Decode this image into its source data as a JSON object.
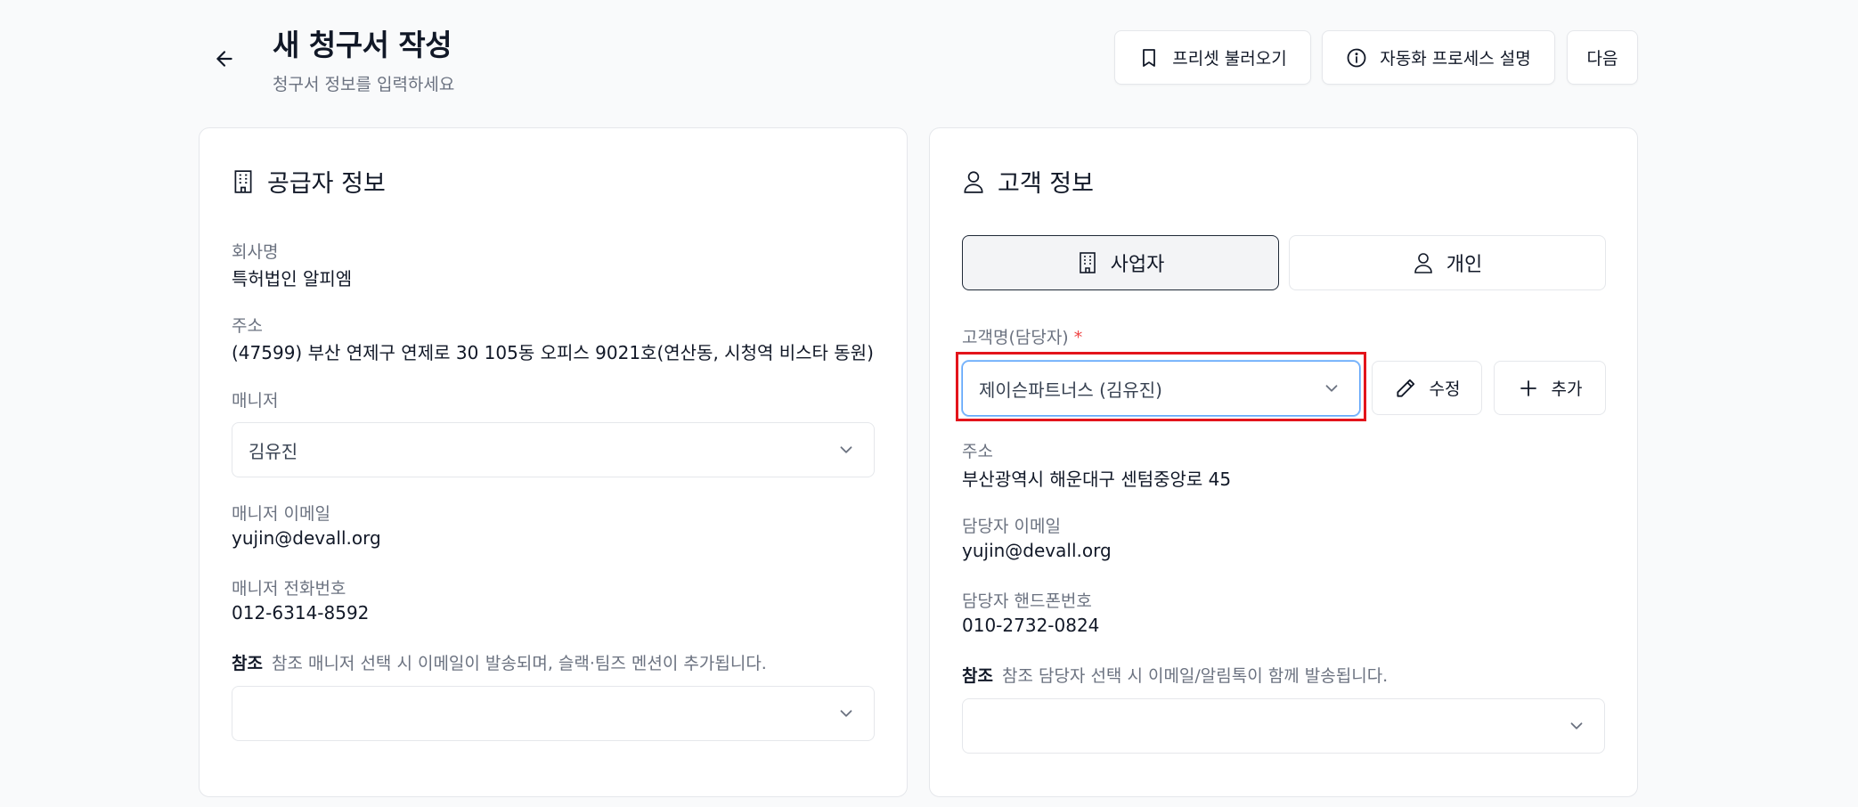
{
  "header": {
    "title": "새 청구서 작성",
    "subtitle": "청구서 정보를 입력하세요",
    "buttons": {
      "preset": "프리셋 불러오기",
      "automation": "자동화 프로세스 설명",
      "next": "다음"
    }
  },
  "supplier": {
    "title": "공급자 정보",
    "company_label": "회사명",
    "company_value": "특허법인 알피엠",
    "address_label": "주소",
    "address_value": "(47599) 부산 연제구 연제로 30 105동 오피스 9021호(연산동, 시청역 비스타 동원)",
    "manager_label": "매니저",
    "manager_selected": "김유진",
    "manager_email_label": "매니저 이메일",
    "manager_email_value": "yujin@devall.org",
    "manager_phone_label": "매니저 전화번호",
    "manager_phone_value": "012-6314-8592",
    "cc_label": "참조",
    "cc_hint": "참조 매니저 선택 시 이메일이 발송되며, 슬랙·팀즈 멘션이 추가됩니다.",
    "cc_selected": ""
  },
  "customer": {
    "title": "고객 정보",
    "type_business": "사업자",
    "type_individual": "개인",
    "active_type": "사업자",
    "name_label": "고객명(담당자)",
    "required_mark": "*",
    "name_selected": "제이슨파트너스 (김유진)",
    "edit_label": "수정",
    "add_label": "추가",
    "address_label": "주소",
    "address_value": "부산광역시 해운대구 센텀중앙로 45",
    "email_label": "담당자 이메일",
    "email_value": "yujin@devall.org",
    "phone_label": "담당자 핸드폰번호",
    "phone_value": "010-2732-0824",
    "cc_label": "참조",
    "cc_hint": "참조 담당자 선택 시 이메일/알림톡이 함께 발송됩니다.",
    "cc_selected": ""
  },
  "colors": {
    "highlight": "#e3141b",
    "required": "#ef4444",
    "focus_border": "#60a5fa"
  },
  "icons": {
    "back": "arrow-left-icon",
    "preset": "bookmark-icon",
    "automation": "info-icon",
    "supplier": "building-icon",
    "customer": "user-icon",
    "dropdown": "chevron-down-icon",
    "edit": "pencil-icon",
    "add": "plus-icon"
  }
}
